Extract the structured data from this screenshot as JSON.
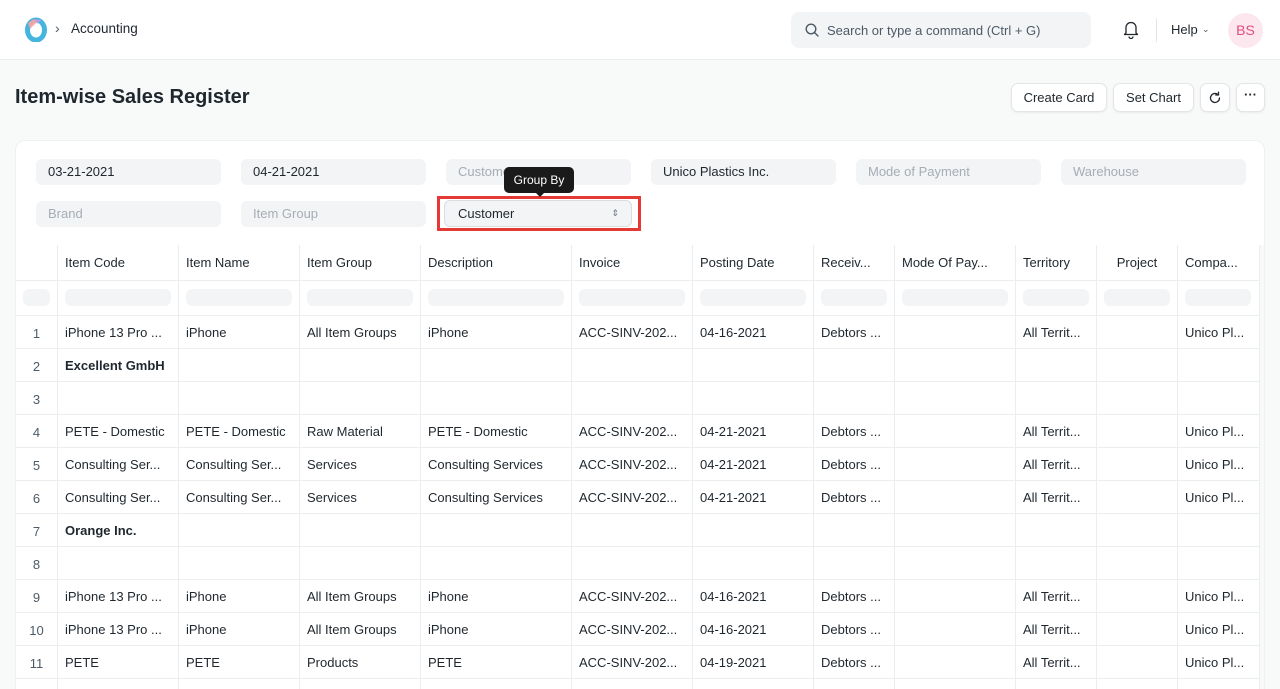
{
  "navbar": {
    "breadcrumb": "Accounting",
    "search_placeholder": "Search or type a command (Ctrl + G)",
    "help_label": "Help",
    "avatar_initials": "BS"
  },
  "page": {
    "title": "Item-wise Sales Register",
    "actions": {
      "create_card": "Create Card",
      "set_chart": "Set Chart",
      "more": "···"
    }
  },
  "filters": {
    "from_date": "03-21-2021",
    "to_date": "04-21-2021",
    "customer_placeholder": "Customer",
    "company": "Unico Plastics Inc.",
    "mode_of_payment_placeholder": "Mode of Payment",
    "warehouse_placeholder": "Warehouse",
    "brand_placeholder": "Brand",
    "item_group_placeholder": "Item Group",
    "group_by": "Customer",
    "group_by_tooltip": "Group By"
  },
  "table": {
    "columns": [
      "Item Code",
      "Item Name",
      "Item Group",
      "Description",
      "Invoice",
      "Posting Date",
      "Receiv...",
      "Mode Of Pay...",
      "Territory",
      "Project",
      "Compa..."
    ],
    "rows": [
      {
        "n": "1",
        "cells": [
          "iPhone 13 Pro ...",
          "iPhone",
          "All Item Groups",
          "iPhone",
          "ACC-SINV-202...",
          "04-16-2021",
          "Debtors ...",
          "",
          "All Territ...",
          "",
          "Unico Pl..."
        ]
      },
      {
        "n": "2",
        "group": true,
        "cells": [
          "Excellent GmbH",
          "",
          "",
          "",
          "",
          "",
          "",
          "",
          "",
          "",
          ""
        ]
      },
      {
        "n": "3",
        "cells": [
          "",
          "",
          "",
          "",
          "",
          "",
          "",
          "",
          "",
          "",
          ""
        ]
      },
      {
        "n": "4",
        "cells": [
          "PETE - Domestic",
          "PETE - Domestic",
          "Raw Material",
          "PETE - Domestic",
          "ACC-SINV-202...",
          "04-21-2021",
          "Debtors ...",
          "",
          "All Territ...",
          "",
          "Unico Pl..."
        ]
      },
      {
        "n": "5",
        "cells": [
          "Consulting Ser...",
          "Consulting Ser...",
          "Services",
          "Consulting Services",
          "ACC-SINV-202...",
          "04-21-2021",
          "Debtors ...",
          "",
          "All Territ...",
          "",
          "Unico Pl..."
        ]
      },
      {
        "n": "6",
        "cells": [
          "Consulting Ser...",
          "Consulting Ser...",
          "Services",
          "Consulting Services",
          "ACC-SINV-202...",
          "04-21-2021",
          "Debtors ...",
          "",
          "All Territ...",
          "",
          "Unico Pl..."
        ]
      },
      {
        "n": "7",
        "group": true,
        "cells": [
          "Orange Inc.",
          "",
          "",
          "",
          "",
          "",
          "",
          "",
          "",
          "",
          ""
        ]
      },
      {
        "n": "8",
        "cells": [
          "",
          "",
          "",
          "",
          "",
          "",
          "",
          "",
          "",
          "",
          ""
        ]
      },
      {
        "n": "9",
        "cells": [
          "iPhone 13 Pro ...",
          "iPhone",
          "All Item Groups",
          "iPhone",
          "ACC-SINV-202...",
          "04-16-2021",
          "Debtors ...",
          "",
          "All Territ...",
          "",
          "Unico Pl..."
        ]
      },
      {
        "n": "10",
        "cells": [
          "iPhone 13 Pro ...",
          "iPhone",
          "All Item Groups",
          "iPhone",
          "ACC-SINV-202...",
          "04-16-2021",
          "Debtors ...",
          "",
          "All Territ...",
          "",
          "Unico Pl..."
        ]
      },
      {
        "n": "11",
        "cells": [
          "PETE",
          "PETE",
          "Products",
          "PETE",
          "ACC-SINV-202...",
          "04-19-2021",
          "Debtors ...",
          "",
          "All Territ...",
          "",
          "Unico Pl..."
        ]
      },
      {
        "n": "",
        "cells": [
          "",
          "",
          "",
          "",
          "",
          "",
          "",
          "",
          "",
          "",
          ""
        ]
      }
    ]
  }
}
